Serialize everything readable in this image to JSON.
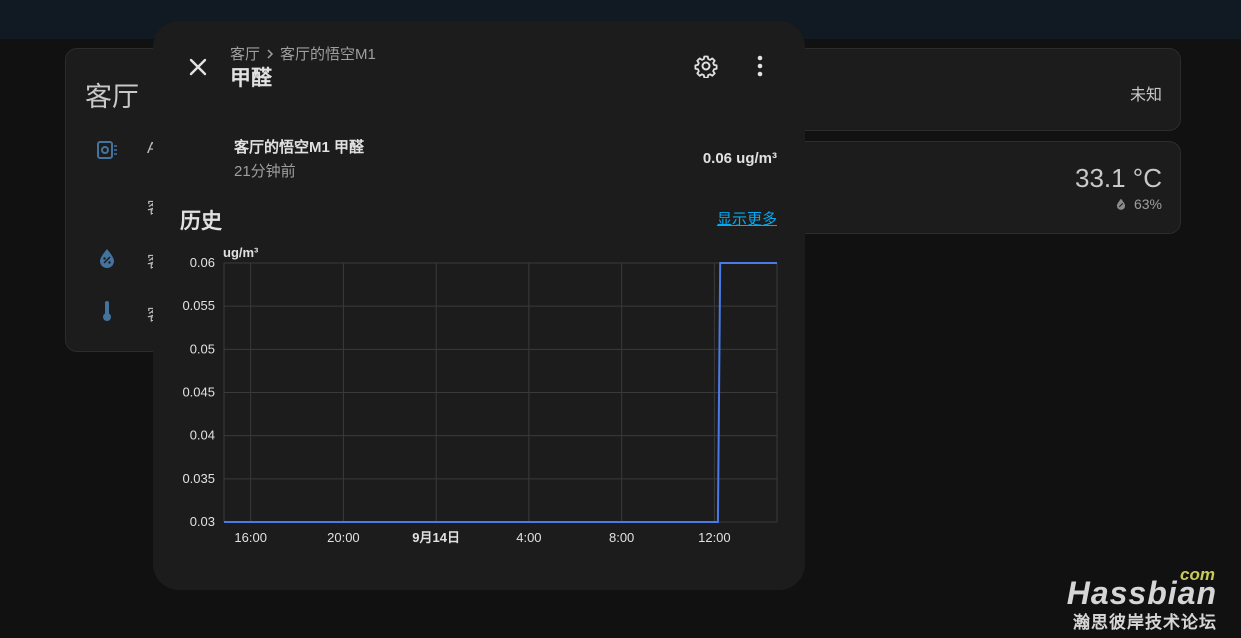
{
  "background": {
    "area_name": "客厅",
    "left_card_rows": [
      "A",
      "客",
      "客",
      "客"
    ],
    "top_right_state": "未知",
    "temperature": "33.1 °C",
    "humidity": "63%"
  },
  "dialog": {
    "breadcrumb_area": "客厅",
    "breadcrumb_device": "客厅的悟空M1",
    "title": "甲醛",
    "entity_name": "客厅的悟空M1 甲醛",
    "last_changed": "21分钟前",
    "state_value": "0.06 ug/m³",
    "history_title": "历史",
    "show_more": "显示更多"
  },
  "chart_data": {
    "type": "line",
    "unit": "ug/m³",
    "ylim": [
      0.03,
      0.06
    ],
    "y_ticks": [
      "0.06",
      "0.055",
      "0.05",
      "0.045",
      "0.04",
      "0.035",
      "0.03"
    ],
    "x_ticks": [
      "16:00",
      "20:00",
      "9月14日",
      "4:00",
      "8:00",
      "12:00"
    ],
    "x_tick_hours": [
      16,
      20,
      24,
      28,
      32,
      36
    ],
    "xlim_hours": [
      14.85,
      38.7
    ],
    "grid": true,
    "series": [
      {
        "color": "#4a7ae8",
        "points": [
          {
            "x": 14.85,
            "y": 0.03
          },
          {
            "x": 36.15,
            "y": 0.03
          },
          {
            "x": 36.25,
            "y": 0.06
          },
          {
            "x": 38.7,
            "y": 0.06
          }
        ]
      }
    ]
  },
  "watermark": {
    "com": "com",
    "brand": "Hassbian",
    "slogan": "瀚思彼岸技术论坛"
  }
}
